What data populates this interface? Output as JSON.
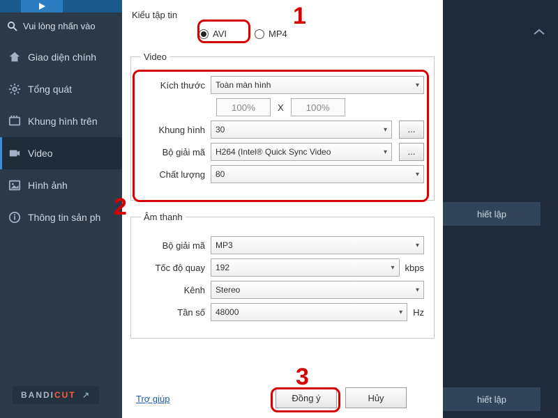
{
  "sidebar": {
    "search": "Vui lòng nhấn vào",
    "items": [
      {
        "label": "Giao diện chính"
      },
      {
        "label": "Tổng quát"
      },
      {
        "label": "Khung hình trên"
      },
      {
        "label": "Video"
      },
      {
        "label": "Hình ảnh"
      },
      {
        "label": "Thông tin sản ph"
      }
    ],
    "brand": "BANDI",
    "brand_cut": "CUT"
  },
  "right": {
    "side_button": "hiết lập"
  },
  "dialog": {
    "file_type": {
      "label": "Kiểu tập tin",
      "opt1": "AVI",
      "opt2": "MP4"
    },
    "video": {
      "legend": "Video",
      "size_label": "Kích thước",
      "size_value": "Toàn màn hình",
      "pct_w": "100%",
      "pct_h": "100%",
      "fps_label": "Khung hình",
      "fps_value": "30",
      "codec_label": "Bộ giải mã",
      "codec_value": "H264 (Intel® Quick Sync Video",
      "quality_label": "Chất lượng",
      "quality_value": "80"
    },
    "audio": {
      "legend": "Âm thanh",
      "codec_label": "Bộ giải mã",
      "codec_value": "MP3",
      "bitrate_label": "Tốc độ quay",
      "bitrate_value": "192",
      "bitrate_unit": "kbps",
      "channel_label": "Kênh",
      "channel_value": "Stereo",
      "freq_label": "Tần số",
      "freq_value": "48000",
      "freq_unit": "Hz"
    },
    "help": "Trợ giúp",
    "ok": "Đồng ý",
    "cancel": "Hủy"
  },
  "callouts": {
    "n1": "1",
    "n2": "2",
    "n3": "3"
  },
  "glyph": {
    "ellipsis": "...",
    "arrow": "↗"
  }
}
